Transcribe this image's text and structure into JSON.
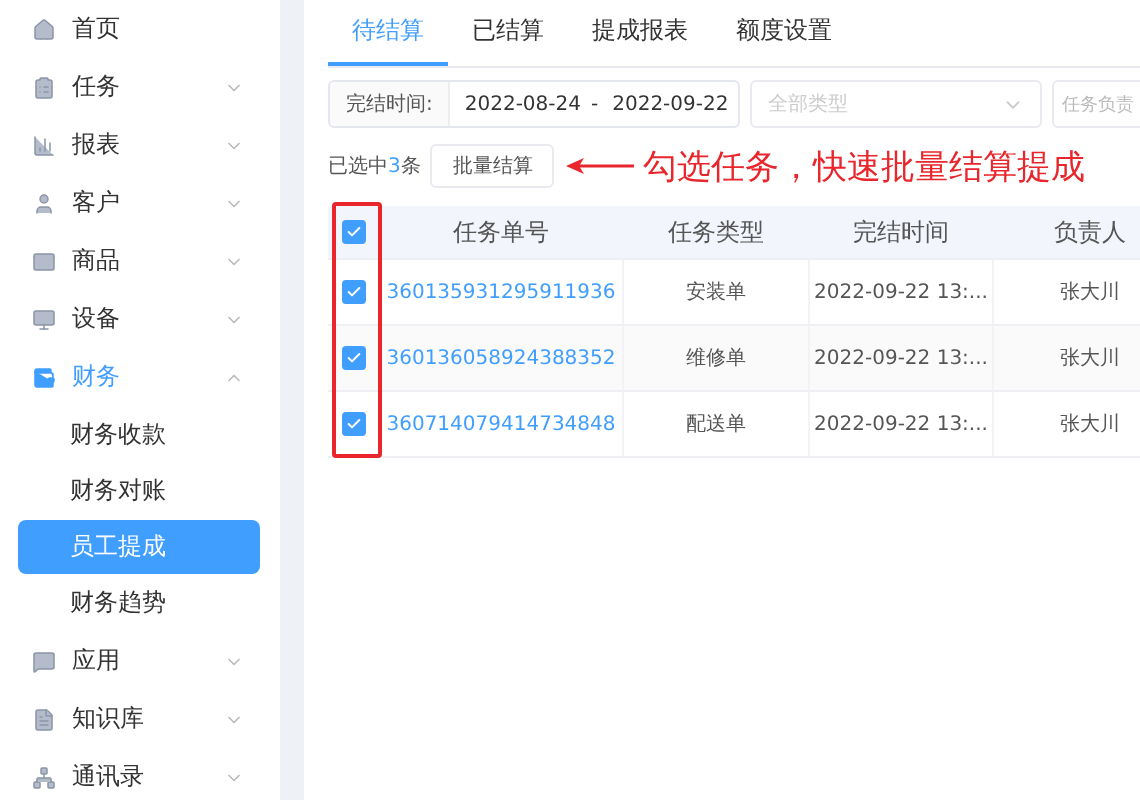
{
  "sidebar": {
    "items": [
      {
        "label": "首页"
      },
      {
        "label": "任务",
        "expanded": false
      },
      {
        "label": "报表",
        "expanded": false
      },
      {
        "label": "客户",
        "expanded": false
      },
      {
        "label": "商品",
        "expanded": false
      },
      {
        "label": "设备",
        "expanded": false
      },
      {
        "label": "财务",
        "expanded": true,
        "children": [
          {
            "label": "财务收款",
            "selected": false
          },
          {
            "label": "财务对账",
            "selected": false
          },
          {
            "label": "员工提成",
            "selected": true
          },
          {
            "label": "财务趋势",
            "selected": false
          }
        ]
      },
      {
        "label": "应用",
        "expanded": false
      },
      {
        "label": "知识库",
        "expanded": false
      },
      {
        "label": "通讯录",
        "expanded": false
      }
    ]
  },
  "tabs": [
    {
      "label": "待结算",
      "selected": true
    },
    {
      "label": "已结算",
      "selected": false
    },
    {
      "label": "提成报表",
      "selected": false
    },
    {
      "label": "额度设置",
      "selected": false
    }
  ],
  "filters": {
    "date_label": "完结时间:",
    "date_from": "2022-08-24",
    "date_separator": "-",
    "date_to": "2022-09-22",
    "type_placeholder": "全部类型",
    "owner_placeholder": "任务负责"
  },
  "selection": {
    "prefix": "已选中",
    "count": "3",
    "suffix": "条",
    "button": "批量结算"
  },
  "annotation": {
    "text": "勾选任务，快速批量结算提成"
  },
  "table": {
    "all_checked": true,
    "columns": [
      "任务单号",
      "任务类型",
      "完结时间",
      "负责人"
    ],
    "rows": [
      {
        "checked": true,
        "cells": [
          "360135931295911936",
          "安装单",
          "2022-09-22 13:...",
          "张大川"
        ]
      },
      {
        "checked": true,
        "cells": [
          "360136058924388352",
          "维修单",
          "2022-09-22 13:...",
          "张大川"
        ]
      },
      {
        "checked": true,
        "cells": [
          "360714079414734848",
          "配送单",
          "2022-09-22 13:...",
          "张大川"
        ]
      }
    ]
  }
}
